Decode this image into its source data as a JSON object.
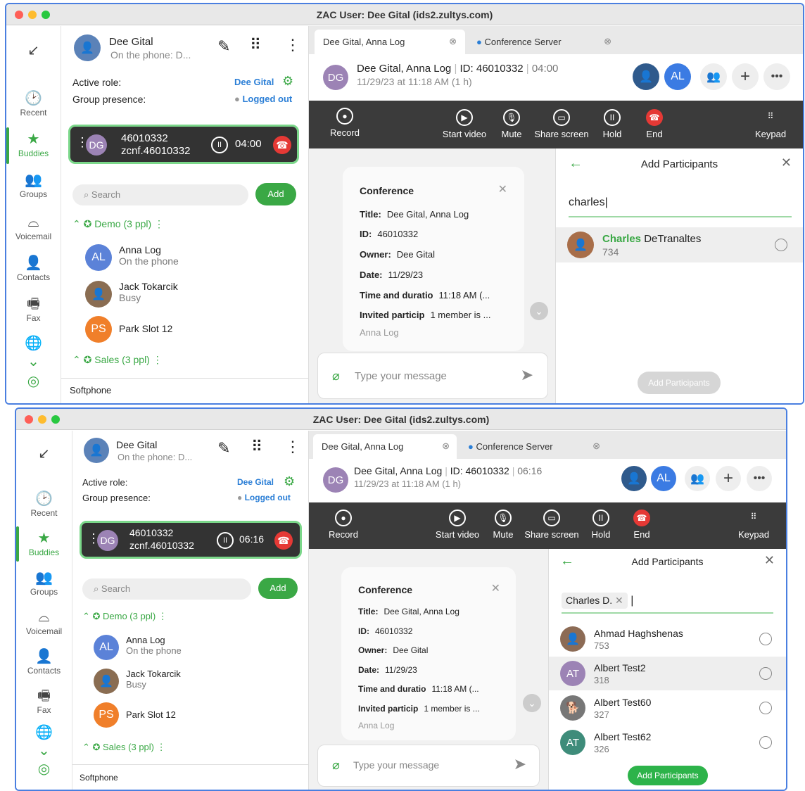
{
  "windows": [
    {
      "title": "ZAC User: Dee Gital (ids2.zultys.com)",
      "user": {
        "name": "Dee Gital",
        "status": "On the phone: D..."
      },
      "active_role_label": "Active role:",
      "active_role_value": "Dee Gital",
      "presence_label": "Group presence:",
      "presence_value": "Logged out",
      "call": {
        "number": "46010332",
        "sub": "zcnf.46010332",
        "initials": "DG",
        "timer": "04:00"
      },
      "search_placeholder": "Search",
      "add_label": "Add",
      "groups": [
        {
          "label": "Demo (3 ppl)",
          "members": [
            {
              "initials": "AL",
              "name": "Anna Log",
              "status": "On the phone"
            },
            {
              "initials": "",
              "name": "Jack Tokarcik",
              "status": "Busy"
            },
            {
              "initials": "PS",
              "name": "Park Slot 12",
              "status": ""
            }
          ]
        },
        {
          "label": "Sales (3 ppl)",
          "members": []
        }
      ],
      "footer": "Softphone",
      "tabs": [
        "Dee Gital, Anna Log",
        "Conference Server"
      ],
      "header": {
        "initials": "DG",
        "title": "Dee Gital, Anna Log",
        "id": "ID: 46010332",
        "time": "04:00",
        "date": "11/29/23 at 11:18 AM (1 h)",
        "right_avatar": "AL"
      },
      "toolbar": [
        "Record",
        "Start video",
        "Mute",
        "Share screen",
        "Hold",
        "End",
        "Keypad"
      ],
      "conference": {
        "heading": "Conference",
        "rows": [
          {
            "k": "Title:",
            "v": "Dee Gital, Anna Log"
          },
          {
            "k": "ID:",
            "v": "46010332"
          },
          {
            "k": "Owner:",
            "v": "Dee Gital"
          },
          {
            "k": "Date:",
            "v": "11/29/23"
          },
          {
            "k": "Time and duratio",
            "v": "11:18 AM (..."
          },
          {
            "k": "Invited particip",
            "v": "1 member is ..."
          }
        ],
        "extra": "Anna Log"
      },
      "message_placeholder": "Type your message",
      "panel": {
        "title": "Add Participants",
        "query": "charles",
        "results": [
          {
            "first": "Charles",
            "rest": " DeTranaltes",
            "ext": "734"
          }
        ],
        "button": "Add Participants"
      }
    },
    {
      "title": "ZAC User: Dee Gital (ids2.zultys.com)",
      "call": {
        "number": "46010332",
        "sub": "zcnf.46010332",
        "initials": "DG",
        "timer": "06:16"
      },
      "header": {
        "time": "06:16"
      },
      "panel": {
        "title": "Add Participants",
        "chip": "Charles D.",
        "results": [
          {
            "initials": "",
            "name": "Ahmad Haghshenas",
            "ext": "753"
          },
          {
            "initials": "AT",
            "name": "Albert Test2",
            "ext": "318"
          },
          {
            "initials": "",
            "name": "Albert Test60",
            "ext": "327"
          },
          {
            "initials": "AT",
            "name": "Albert Test62",
            "ext": "326"
          }
        ],
        "button": "Add Participants"
      }
    }
  ],
  "rail": [
    "Recent",
    "Buddies",
    "Groups",
    "Voicemail",
    "Contacts",
    "Fax"
  ],
  "colors": {
    "accent": "#3aa845",
    "blue": "#2a7ed6",
    "dark": "#3b3b3b",
    "end": "#e53935",
    "purple_avatar": "#9c83b5"
  }
}
